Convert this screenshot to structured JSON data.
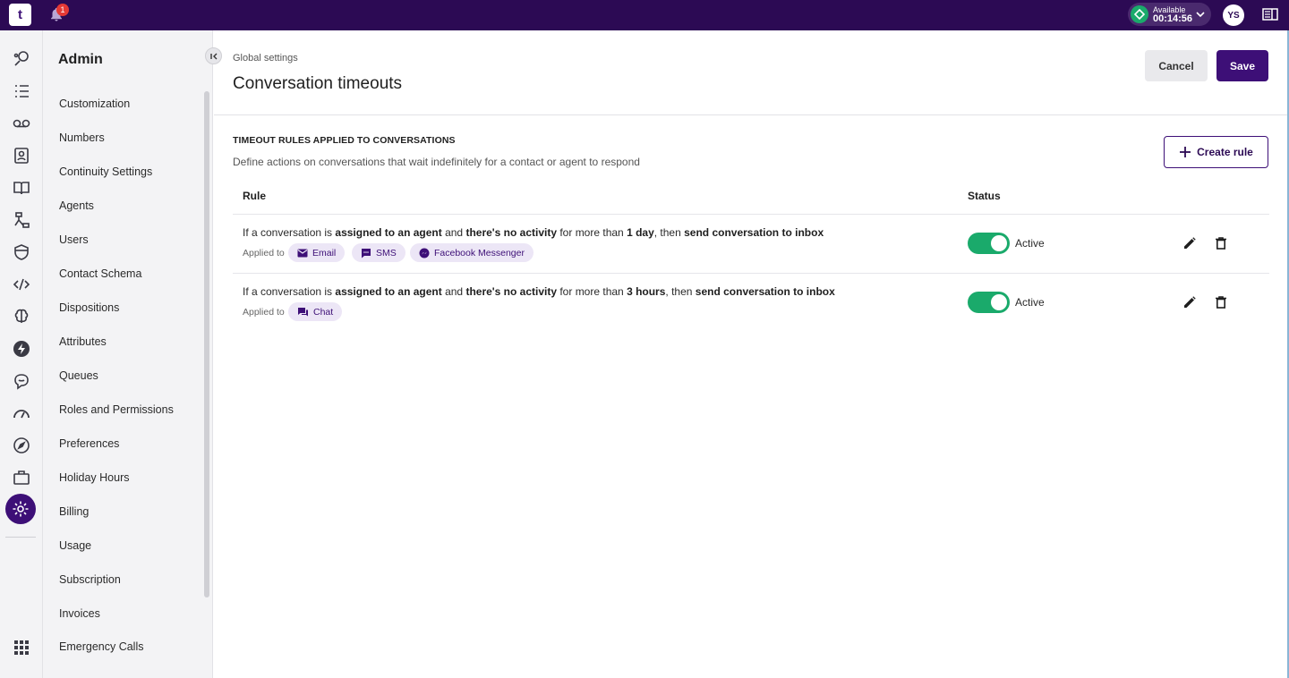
{
  "topbar": {
    "logo_text": "t",
    "notification_count": "1",
    "agent_status": "Available",
    "timer": "00:14:56",
    "user_initials": "YS",
    "status_color": "#1aaa6b"
  },
  "rail": {
    "icons": [
      "conversations-icon",
      "tasks-list-icon",
      "voicemail-icon",
      "contacts-icon",
      "knowledge-base-icon",
      "workflows-icon",
      "shield-icon",
      "code-icon",
      "ai-brain-icon",
      "automation-bolt-icon",
      "chat-bubble-icon",
      "dashboard-gauge-icon",
      "explore-compass-icon",
      "briefcase-icon",
      "settings-gear-icon",
      "apps-grid-icon"
    ],
    "active": "settings-gear-icon"
  },
  "admin_nav": {
    "title": "Admin",
    "items": [
      "Customization",
      "Numbers",
      "Continuity Settings",
      "Agents",
      "Users",
      "Contact Schema",
      "Dispositions",
      "Attributes",
      "Queues",
      "Roles and Permissions",
      "Preferences",
      "Holiday Hours",
      "Billing",
      "Usage",
      "Subscription",
      "Invoices",
      "Emergency Calls"
    ]
  },
  "page": {
    "breadcrumb": "Global settings",
    "title": "Conversation timeouts",
    "cancel_label": "Cancel",
    "save_label": "Save",
    "section_title": "TIMEOUT RULES APPLIED TO CONVERSATIONS",
    "section_desc": "Define actions on conversations that wait indefinitely for a contact or agent to respond",
    "create_label": "Create rule",
    "col_rule": "Rule",
    "col_status": "Status",
    "accent": "#3d0f77"
  },
  "rules": [
    {
      "p1": "If a conversation is ",
      "b1": "assigned to an agent",
      "p2": " and ",
      "b2": "there's no activity",
      "p3": " for more than ",
      "b3": "1 day",
      "p4": ", then ",
      "b4": "send conversation to inbox",
      "applied_label": "Applied to",
      "channels": [
        {
          "label": "Email",
          "icon": "email-icon"
        },
        {
          "label": "SMS",
          "icon": "sms-icon"
        },
        {
          "label": "Facebook Messenger",
          "icon": "messenger-icon"
        }
      ],
      "status": "Active",
      "enabled": true
    },
    {
      "p1": "If a conversation is ",
      "b1": "assigned to an agent",
      "p2": " and ",
      "b2": "there's no activity",
      "p3": " for more than ",
      "b3": "3 hours",
      "p4": ", then ",
      "b4": "send conversation to inbox",
      "applied_label": "Applied to",
      "channels": [
        {
          "label": "Chat",
          "icon": "chat-icon"
        }
      ],
      "status": "Active",
      "enabled": true
    }
  ]
}
